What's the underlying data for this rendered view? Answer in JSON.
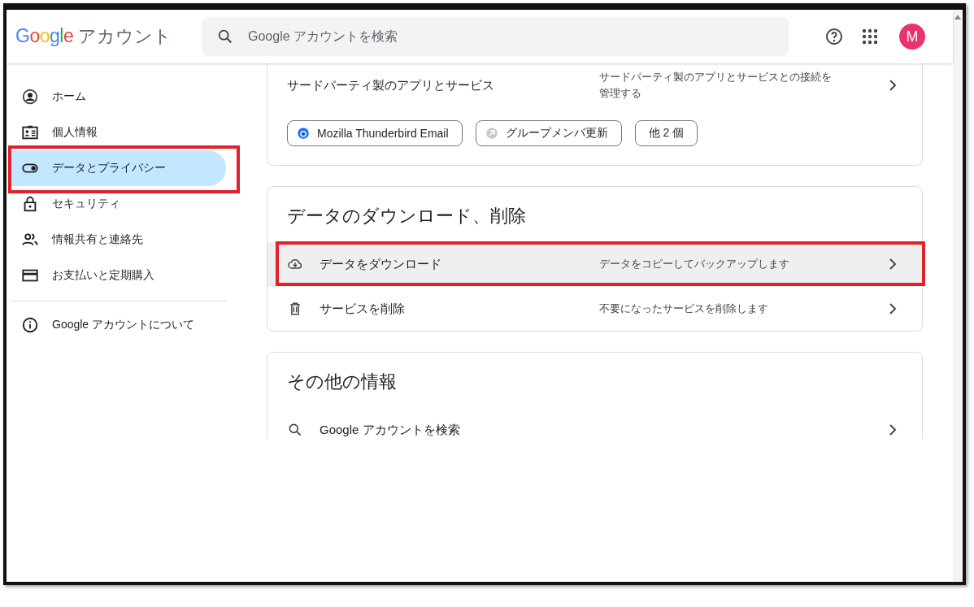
{
  "header": {
    "logo": {
      "brand": "Google",
      "product": "アカウント"
    },
    "search": {
      "placeholder": "Google アカウントを検索"
    },
    "avatar": {
      "initial": "M",
      "color": "#e8336d"
    }
  },
  "sidebar": {
    "items": [
      {
        "label": "ホーム",
        "selected": false,
        "highlighted": false
      },
      {
        "label": "個人情報",
        "selected": false,
        "highlighted": false
      },
      {
        "label": "データとプライバシー",
        "selected": true,
        "highlighted": true
      },
      {
        "label": "セキュリティ",
        "selected": false,
        "highlighted": false
      },
      {
        "label": "情報共有と連絡先",
        "selected": false,
        "highlighted": false
      },
      {
        "label": "お支払いと定期購入",
        "selected": false,
        "highlighted": false
      }
    ],
    "footer_items": [
      {
        "label": "Google アカウントについて",
        "selected": false,
        "highlighted": false
      }
    ]
  },
  "cards": [
    {
      "cut_top": true,
      "rows": [
        {
          "label": "サードパーティ製のアプリとサービス",
          "description": "サードパーティ製のアプリとサービスとの接続を管理する",
          "hovered": false,
          "highlighted": false
        }
      ],
      "chips": [
        {
          "kind": "app",
          "label": "Mozilla Thunderbird Email"
        },
        {
          "kind": "app",
          "label": "グループメンバ更新"
        },
        {
          "kind": "more",
          "label": "他 2 個"
        }
      ]
    },
    {
      "cut_top": false,
      "title": "データのダウンロード、削除",
      "rows": [
        {
          "label": "データをダウンロード",
          "description": "データをコピーしてバックアップします",
          "hovered": true,
          "highlighted": true
        },
        {
          "label": "サービスを削除",
          "description": "不要になったサービスを削除します",
          "hovered": false,
          "highlighted": false
        }
      ]
    },
    {
      "cut_top": false,
      "title": "その他の情報",
      "rows": [
        {
          "label": "Google アカウントを検索",
          "hovered": false,
          "highlighted": false
        }
      ]
    }
  ]
}
